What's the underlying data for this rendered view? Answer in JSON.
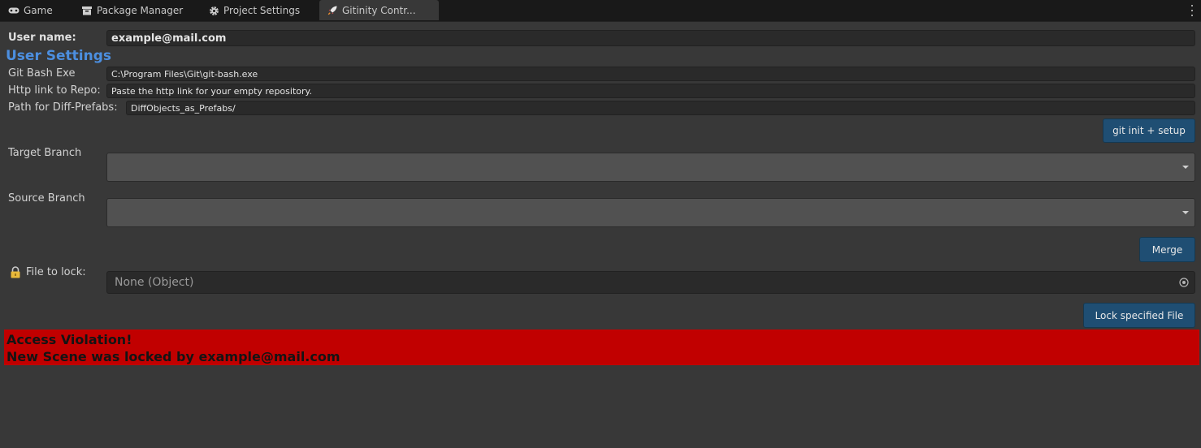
{
  "tabs": [
    {
      "label": "Game",
      "icon": "gamepad-icon"
    },
    {
      "label": "Package Manager",
      "icon": "package-icon"
    },
    {
      "label": "Project Settings",
      "icon": "gear-icon"
    },
    {
      "label": "Gitinity Contr...",
      "icon": "rocket-icon",
      "active": true
    }
  ],
  "user": {
    "label": "User name:",
    "value": "example@mail.com"
  },
  "settings": {
    "heading": "User Settings",
    "heading_color": "#4c8fe0",
    "git_bash_label": "Git Bash Exe",
    "git_bash_value": "C:\\Program Files\\Git\\git-bash.exe",
    "repo_label": "Http link to Repo:",
    "repo_value": "Paste the http link for your empty repository.",
    "diff_label": "Path for Diff-Prefabs:",
    "diff_value": "DiffObjects_as_Prefabs/",
    "setup_button": "git init + setup"
  },
  "branches": {
    "target_label": "Target Branch",
    "target_value": "",
    "source_label": "Source Branch",
    "source_value": "",
    "merge_button": "Merge"
  },
  "lock": {
    "label": "File to lock:",
    "icon": "lock-icon",
    "value": "None (Object)",
    "button": "Lock specified File"
  },
  "alert": {
    "line1": "Access Violation!",
    "line2": "New Scene was locked by example@mail.com",
    "bg_color": "#c10000"
  },
  "colors": {
    "background": "#383838",
    "tabbar": "#191919",
    "button": "#1f4e73"
  }
}
